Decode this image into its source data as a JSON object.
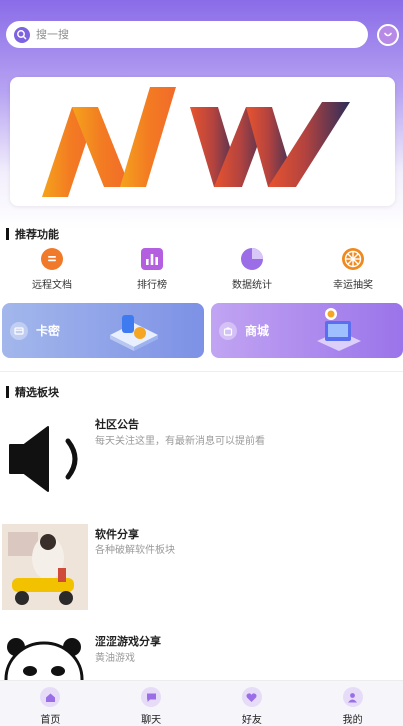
{
  "search": {
    "placeholder": "搜一搜",
    "icon": "search-icon"
  },
  "header": {
    "user_icon": "smile-icon"
  },
  "banner": {
    "logo_text": "NW"
  },
  "sections": {
    "recommended": "推荐功能",
    "featured": "精选板块"
  },
  "features": [
    {
      "label": "远程文档",
      "icon": "document-icon",
      "color": "#f07a2a"
    },
    {
      "label": "排行榜",
      "icon": "bar-chart-icon",
      "color": "#b45fe0"
    },
    {
      "label": "数据统计",
      "icon": "pie-chart-icon",
      "color": "#9b6ee8"
    },
    {
      "label": "幸运抽奖",
      "icon": "wheel-icon",
      "color": "#f08a1e"
    }
  ],
  "cards": [
    {
      "label": "卡密",
      "icon": "card-icon"
    },
    {
      "label": "商城",
      "icon": "bag-icon"
    }
  ],
  "posts": [
    {
      "title": "社区公告",
      "desc": "每天关注这里，有最新消息可以提前看"
    },
    {
      "title": "软件分享",
      "desc": "各种破解软件板块"
    },
    {
      "title": "涩涩游戏分享",
      "desc": "黄油游戏"
    }
  ],
  "tabbar": [
    {
      "label": "首页",
      "icon": "home-icon"
    },
    {
      "label": "聊天",
      "icon": "chat-icon"
    },
    {
      "label": "好友",
      "icon": "heart-icon"
    },
    {
      "label": "我的",
      "icon": "user-icon"
    }
  ],
  "colors": {
    "accent": "#8a6ce8",
    "card1": "#7b8ee8",
    "card2": "#a986ee"
  }
}
